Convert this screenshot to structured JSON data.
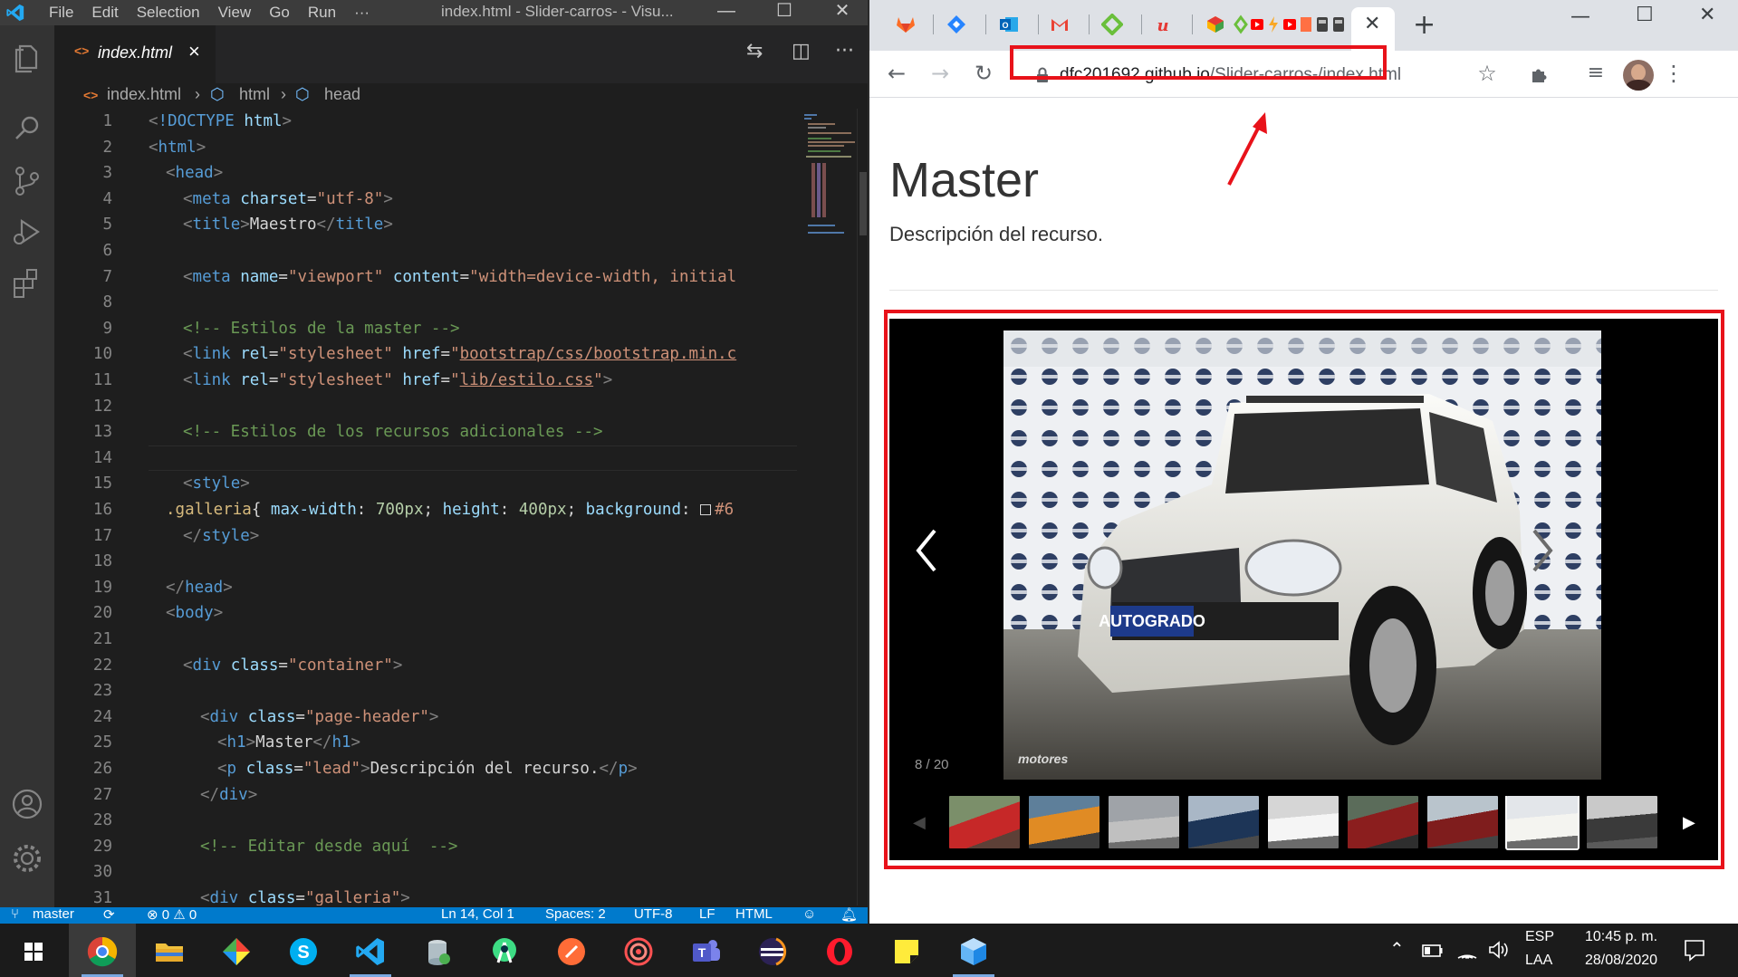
{
  "vscode": {
    "menu": [
      "File",
      "Edit",
      "Selection",
      "View",
      "Go",
      "Run",
      "···"
    ],
    "window_title": "index.html - Slider-carros- - Visu...",
    "tab": {
      "label": "index.html"
    },
    "breadcrumb": [
      "index.html",
      "html",
      "head"
    ],
    "lines": [
      {
        "n": "1",
        "segs": [
          [
            "br",
            "<"
          ],
          [
            "tag",
            "!DOCTYPE"
          ],
          [
            "txt",
            " "
          ],
          [
            "att",
            "html"
          ],
          [
            "br",
            ">"
          ]
        ],
        "ind": 0
      },
      {
        "n": "2",
        "segs": [
          [
            "br",
            "<"
          ],
          [
            "tag",
            "html"
          ],
          [
            "br",
            ">"
          ]
        ],
        "ind": 0
      },
      {
        "n": "3",
        "segs": [
          [
            "br",
            "<"
          ],
          [
            "tag",
            "head"
          ],
          [
            "br",
            ">"
          ]
        ],
        "ind": 1
      },
      {
        "n": "4",
        "segs": [
          [
            "br",
            "<"
          ],
          [
            "tag",
            "meta"
          ],
          [
            "txt",
            " "
          ],
          [
            "att",
            "charset"
          ],
          [
            "txt",
            "="
          ],
          [
            "str",
            "\"utf-8\""
          ],
          [
            "br",
            ">"
          ]
        ],
        "ind": 2
      },
      {
        "n": "5",
        "segs": [
          [
            "br",
            "<"
          ],
          [
            "tag",
            "title"
          ],
          [
            "br",
            ">"
          ],
          [
            "txt",
            "Maestro"
          ],
          [
            "br",
            "</"
          ],
          [
            "tag",
            "title"
          ],
          [
            "br",
            ">"
          ]
        ],
        "ind": 2
      },
      {
        "n": "6",
        "segs": [],
        "ind": 0
      },
      {
        "n": "7",
        "segs": [
          [
            "br",
            "<"
          ],
          [
            "tag",
            "meta"
          ],
          [
            "txt",
            " "
          ],
          [
            "att",
            "name"
          ],
          [
            "txt",
            "="
          ],
          [
            "str",
            "\"viewport\""
          ],
          [
            "txt",
            " "
          ],
          [
            "att",
            "content"
          ],
          [
            "txt",
            "="
          ],
          [
            "str",
            "\"width=device-width, initial"
          ]
        ],
        "ind": 2
      },
      {
        "n": "8",
        "segs": [],
        "ind": 0
      },
      {
        "n": "9",
        "segs": [
          [
            "com",
            "<!-- Estilos de la master -->"
          ]
        ],
        "ind": 2
      },
      {
        "n": "10",
        "segs": [
          [
            "br",
            "<"
          ],
          [
            "tag",
            "link"
          ],
          [
            "txt",
            " "
          ],
          [
            "att",
            "rel"
          ],
          [
            "txt",
            "="
          ],
          [
            "str",
            "\"stylesheet\""
          ],
          [
            "txt",
            " "
          ],
          [
            "att",
            "href"
          ],
          [
            "txt",
            "="
          ],
          [
            "str",
            "\""
          ],
          [
            "stru",
            "bootstrap/css/bootstrap.min.c"
          ]
        ],
        "ind": 2
      },
      {
        "n": "11",
        "segs": [
          [
            "br",
            "<"
          ],
          [
            "tag",
            "link"
          ],
          [
            "txt",
            " "
          ],
          [
            "att",
            "rel"
          ],
          [
            "txt",
            "="
          ],
          [
            "str",
            "\"stylesheet\""
          ],
          [
            "txt",
            " "
          ],
          [
            "att",
            "href"
          ],
          [
            "txt",
            "="
          ],
          [
            "str",
            "\""
          ],
          [
            "stru",
            "lib/estilo.css"
          ],
          [
            "str",
            "\""
          ],
          [
            "br",
            ">"
          ]
        ],
        "ind": 2
      },
      {
        "n": "12",
        "segs": [],
        "ind": 0
      },
      {
        "n": "13",
        "segs": [
          [
            "com",
            "<!-- Estilos de los recursos adicionales -->"
          ]
        ],
        "ind": 2
      },
      {
        "n": "14",
        "segs": [],
        "ind": 0
      },
      {
        "n": "15",
        "segs": [
          [
            "br",
            "<"
          ],
          [
            "tag",
            "style"
          ],
          [
            "br",
            ">"
          ]
        ],
        "ind": 2
      },
      {
        "n": "16",
        "segs": [
          [
            "sel",
            ".galleria"
          ],
          [
            "txt",
            "{ "
          ],
          [
            "att",
            "max-width"
          ],
          [
            "txt",
            ": "
          ],
          [
            "num",
            "700px"
          ],
          [
            "txt",
            "; "
          ],
          [
            "att",
            "height"
          ],
          [
            "txt",
            ": "
          ],
          [
            "num",
            "400px"
          ],
          [
            "txt",
            "; "
          ],
          [
            "att",
            "background"
          ],
          [
            "txt",
            ": "
          ],
          [
            "box",
            ""
          ],
          [
            "str",
            "#6"
          ]
        ],
        "ind": 1
      },
      {
        "n": "17",
        "segs": [
          [
            "br",
            "</"
          ],
          [
            "tag",
            "style"
          ],
          [
            "br",
            ">"
          ]
        ],
        "ind": 2
      },
      {
        "n": "18",
        "segs": [],
        "ind": 0
      },
      {
        "n": "19",
        "segs": [
          [
            "br",
            "</"
          ],
          [
            "tag",
            "head"
          ],
          [
            "br",
            ">"
          ]
        ],
        "ind": 1
      },
      {
        "n": "20",
        "segs": [
          [
            "br",
            "<"
          ],
          [
            "tag",
            "body"
          ],
          [
            "br",
            ">"
          ]
        ],
        "ind": 1
      },
      {
        "n": "21",
        "segs": [],
        "ind": 0
      },
      {
        "n": "22",
        "segs": [
          [
            "br",
            "<"
          ],
          [
            "tag",
            "div"
          ],
          [
            "txt",
            " "
          ],
          [
            "att",
            "class"
          ],
          [
            "txt",
            "="
          ],
          [
            "str",
            "\"container\""
          ],
          [
            "br",
            ">"
          ]
        ],
        "ind": 2
      },
      {
        "n": "23",
        "segs": [],
        "ind": 0
      },
      {
        "n": "24",
        "segs": [
          [
            "br",
            "<"
          ],
          [
            "tag",
            "div"
          ],
          [
            "txt",
            " "
          ],
          [
            "att",
            "class"
          ],
          [
            "txt",
            "="
          ],
          [
            "str",
            "\"page-header\""
          ],
          [
            "br",
            ">"
          ]
        ],
        "ind": 3
      },
      {
        "n": "25",
        "segs": [
          [
            "br",
            "<"
          ],
          [
            "tag",
            "h1"
          ],
          [
            "br",
            ">"
          ],
          [
            "txt",
            "Master"
          ],
          [
            "br",
            "</"
          ],
          [
            "tag",
            "h1"
          ],
          [
            "br",
            ">"
          ]
        ],
        "ind": 4
      },
      {
        "n": "26",
        "segs": [
          [
            "br",
            "<"
          ],
          [
            "tag",
            "p"
          ],
          [
            "txt",
            " "
          ],
          [
            "att",
            "class"
          ],
          [
            "txt",
            "="
          ],
          [
            "str",
            "\"lead\""
          ],
          [
            "br",
            ">"
          ],
          [
            "txt",
            "Descripción del recurso."
          ],
          [
            "br",
            "</"
          ],
          [
            "tag",
            "p"
          ],
          [
            "br",
            ">"
          ]
        ],
        "ind": 4
      },
      {
        "n": "27",
        "segs": [
          [
            "br",
            "</"
          ],
          [
            "tag",
            "div"
          ],
          [
            "br",
            ">"
          ]
        ],
        "ind": 3
      },
      {
        "n": "28",
        "segs": [],
        "ind": 0
      },
      {
        "n": "29",
        "segs": [
          [
            "com",
            "<!-- Editar desde aquí  -->"
          ]
        ],
        "ind": 3
      },
      {
        "n": "30",
        "segs": [],
        "ind": 0
      },
      {
        "n": "31",
        "segs": [
          [
            "br",
            "<"
          ],
          [
            "tag",
            "div"
          ],
          [
            "txt",
            " "
          ],
          [
            "att",
            "class"
          ],
          [
            "txt",
            "="
          ],
          [
            "str",
            "\"galleria\""
          ],
          [
            "br",
            ">"
          ]
        ],
        "ind": 3
      }
    ],
    "status": {
      "branch": "master",
      "problems": "⊗ 0 ⚠ 0",
      "cursor": "Ln 14, Col 1",
      "spaces": "Spaces: 2",
      "encoding": "UTF-8",
      "eol": "LF",
      "language": "HTML"
    }
  },
  "chrome": {
    "url_host": "dfc201692.github.io",
    "url_path": "/Slider-carros-/index.html",
    "page": {
      "title": "Master",
      "lead": "Descripción del recurso.",
      "counter": "8 / 20",
      "watermark": "motores",
      "plate": "AUTOGRADO"
    }
  },
  "taskbar": {
    "lang_top": "ESP",
    "lang_bottom": "LAA",
    "time": "10:45 p. m.",
    "date": "28/08/2020"
  },
  "colors": {
    "vscode_bg": "#1e1e1e",
    "statusbar": "#007acc",
    "highlight_red": "#e8121a"
  }
}
